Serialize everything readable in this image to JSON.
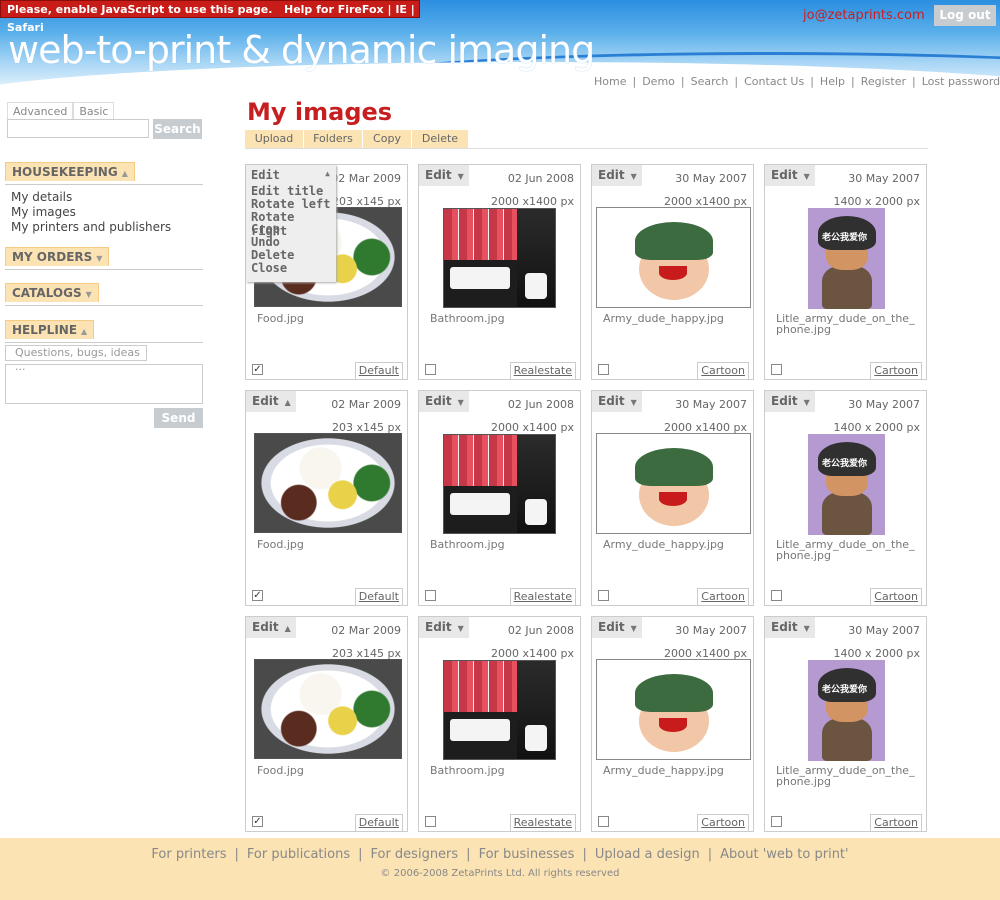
{
  "js_notice": {
    "text": "Please, enable JavaScript to use this page.",
    "help": "Help for FireFox",
    "ie": "IE",
    "safari": "Safari",
    "sep": "|"
  },
  "header": {
    "logo": "web-to-print & dynamic imaging",
    "email": "jo@zetaprints.com",
    "logout": "Log out",
    "nav": [
      "Home",
      "Demo",
      "Search",
      "Contact Us",
      "Help",
      "Register",
      "Lost password"
    ]
  },
  "sidebar": {
    "search_tabs": [
      "Advanced",
      "Basic"
    ],
    "search_value": "",
    "search_button": "Search",
    "sections": [
      {
        "title": "HOUSEKEEPING",
        "icon": "triangle-up-icon",
        "items": [
          "My details",
          "My images",
          "My printers and publishers"
        ]
      },
      {
        "title": "MY ORDERS",
        "icon": "triangle-down-icon",
        "items": []
      },
      {
        "title": "CATALOGS",
        "icon": "triangle-down-icon",
        "items": []
      },
      {
        "title": "HELPLINE",
        "icon": "triangle-up-icon",
        "items": []
      }
    ],
    "help_placeholder": "Questions, bugs, ideas ...",
    "send": "Send"
  },
  "main": {
    "title": "My images",
    "actions": [
      "Upload",
      "Folders",
      "Copy",
      "Delete"
    ],
    "edit_label": "Edit",
    "edit_menu": [
      "Edit title",
      "Rotate left",
      "Rotate right",
      "Crop",
      "Undo",
      "Delete",
      "Close"
    ],
    "images": [
      {
        "date": "02 Mar 2009",
        "dims": "203 x145 px",
        "name": "Food.jpg",
        "category": "Default",
        "checked": true,
        "kind": "food"
      },
      {
        "date": "02 Jun 2008",
        "dims": "2000 x1400 px",
        "name": "Bathroom.jpg",
        "category": "Realestate",
        "checked": false,
        "kind": "bath"
      },
      {
        "date": "30 May 2007",
        "dims": "2000 x1400 px",
        "name": "Army_dude_happy.jpg",
        "category": "Cartoon",
        "checked": false,
        "kind": "army"
      },
      {
        "date": "30 May 2007",
        "dims": "1400 x 2000 px",
        "name": "Litle_army_dude_on_the_phone.jpg",
        "category": "Cartoon",
        "checked": false,
        "kind": "phone"
      }
    ],
    "phone_caption": "老公我爱你",
    "check_mark": "✓"
  },
  "footer": {
    "links": [
      "For printers",
      "For publications",
      "For designers",
      "For businesses",
      "Upload a design",
      "About 'web to print'"
    ],
    "copyright": "© 2006-2008 ZetaPrints Ltd. All rights reserved"
  },
  "colors": {
    "accent_red": "#c71f1f",
    "tab_bg": "#fbe3b4",
    "button_grey": "#c7ccd1"
  }
}
